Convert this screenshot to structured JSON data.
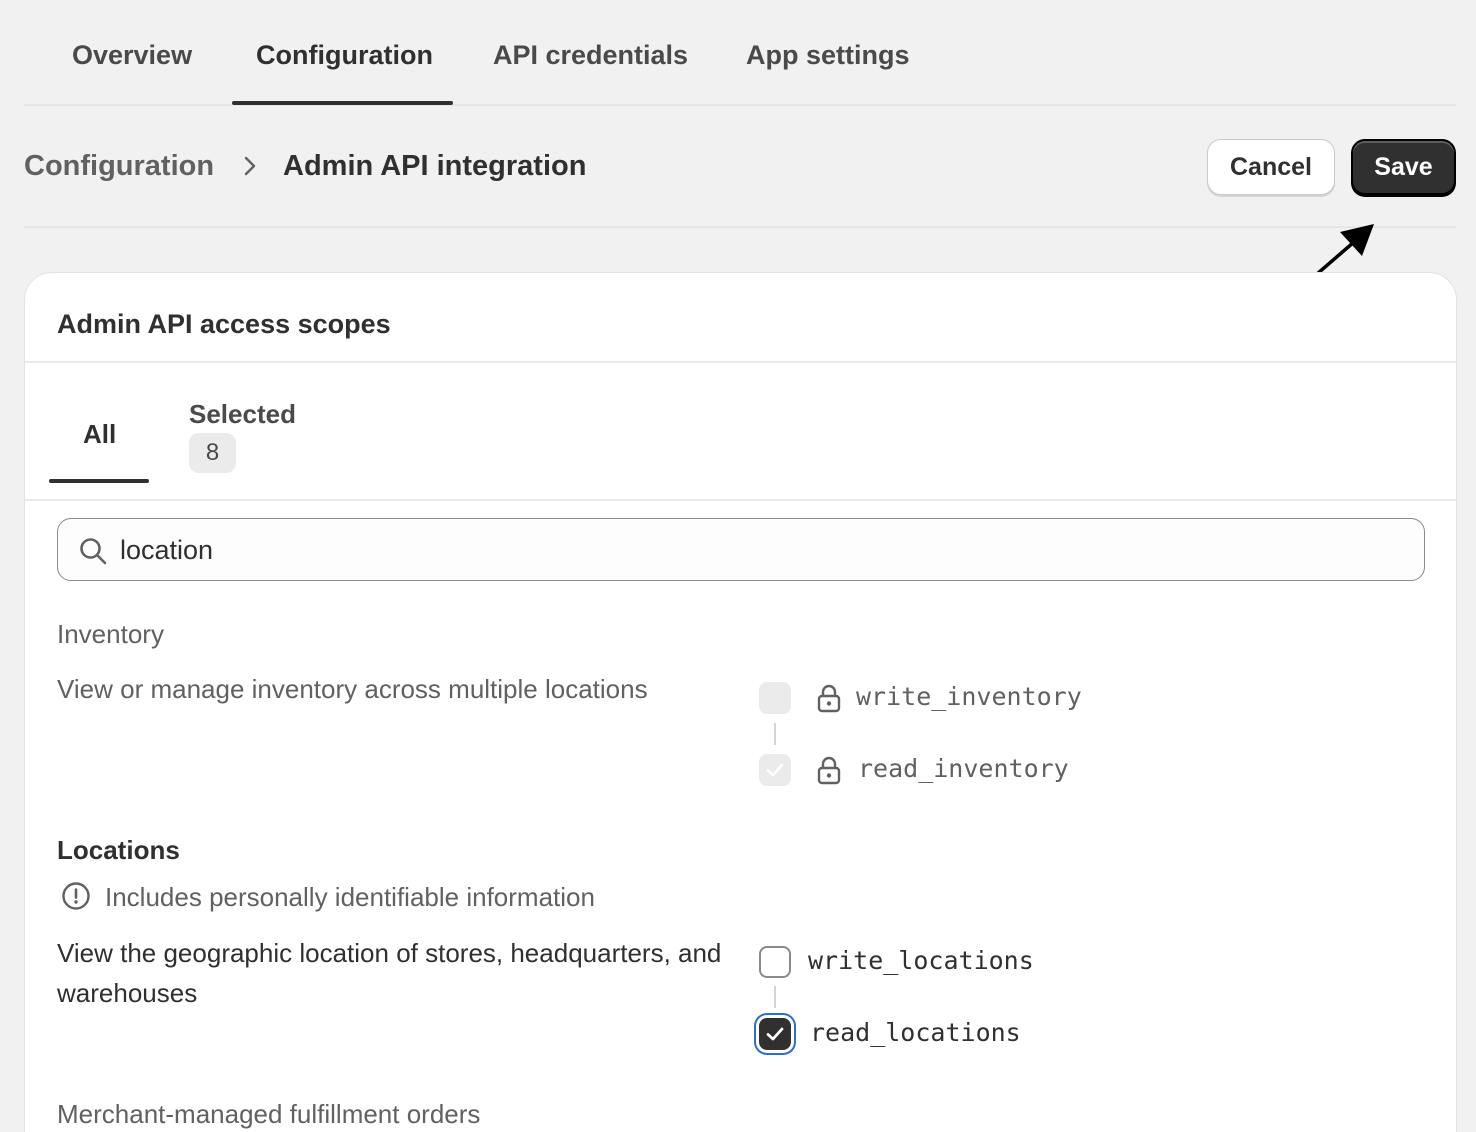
{
  "top_tabs": {
    "overview": "Overview",
    "configuration": "Configuration",
    "api_credentials": "API credentials",
    "app_settings": "App settings"
  },
  "header": {
    "breadcrumb_parent": "Configuration",
    "breadcrumb_current": "Admin API integration",
    "cancel_label": "Cancel",
    "save_label": "Save"
  },
  "card": {
    "title": "Admin API access scopes",
    "tabs": {
      "all_label": "All",
      "selected_label": "Selected",
      "selected_count": "8"
    },
    "search": {
      "value": "location",
      "icon": "search-icon"
    },
    "groups": [
      {
        "title": "Inventory",
        "description": "View or manage inventory across multiple locations",
        "scopes": [
          {
            "name": "write_inventory",
            "state": "disabled",
            "locked": true
          },
          {
            "name": "read_inventory",
            "state": "disabled-checked",
            "locked": true
          }
        ]
      },
      {
        "title": "Locations",
        "notice": "Includes personally identifiable information",
        "description": "View the geographic location of stores, headquarters, and warehouses",
        "scopes": [
          {
            "name": "write_locations",
            "state": "unchecked",
            "locked": false
          },
          {
            "name": "read_locations",
            "state": "checked",
            "locked": false
          }
        ]
      },
      {
        "title": "Merchant-managed fulfillment orders"
      }
    ]
  },
  "colors": {
    "background": "#f1f1f1",
    "primary_button": "#303030",
    "focus_ring": "#2c6ecb",
    "text_secondary": "#616161"
  }
}
